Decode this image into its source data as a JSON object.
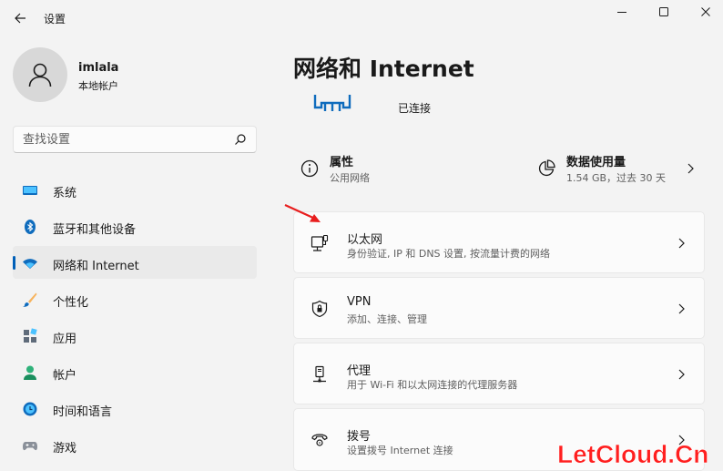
{
  "window": {
    "app_title": "设置"
  },
  "profile": {
    "name": "imlala",
    "account_type": "本地帐户"
  },
  "search": {
    "placeholder": "查找设置"
  },
  "nav": {
    "items": [
      {
        "label": "系统",
        "icon": "system-icon"
      },
      {
        "label": "蓝牙和其他设备",
        "icon": "bluetooth-icon"
      },
      {
        "label": "网络和 Internet",
        "icon": "wifi-icon",
        "active": true
      },
      {
        "label": "个性化",
        "icon": "brush-icon"
      },
      {
        "label": "应用",
        "icon": "apps-icon"
      },
      {
        "label": "帐户",
        "icon": "person-icon"
      },
      {
        "label": "时间和语言",
        "icon": "globe-clock-icon"
      },
      {
        "label": "游戏",
        "icon": "gamepad-icon"
      }
    ]
  },
  "main": {
    "title": "网络和 Internet",
    "connection_status": "已连接",
    "properties": {
      "title": "属性",
      "subtitle": "公用网络"
    },
    "data_usage": {
      "title": "数据使用量",
      "subtitle": "1.54 GB，过去 30 天"
    },
    "cards": [
      {
        "title": "以太网",
        "subtitle": "身份验证, IP 和 DNS 设置, 按流量计费的网络",
        "icon": "ethernet-icon"
      },
      {
        "title": "VPN",
        "subtitle": "添加、连接、管理",
        "icon": "vpn-shield-icon"
      },
      {
        "title": "代理",
        "subtitle": "用于 Wi-Fi 和以太网连接的代理服务器",
        "icon": "proxy-server-icon"
      },
      {
        "title": "拨号",
        "subtitle": "设置拨号 Internet 连接",
        "icon": "dialup-icon"
      }
    ]
  },
  "watermark": "LetCloud.Cn",
  "colors": {
    "accent": "#005fb8",
    "background": "#f3f3f3",
    "card": "#fbfbfb",
    "annotation_arrow": "#e81e1e"
  }
}
